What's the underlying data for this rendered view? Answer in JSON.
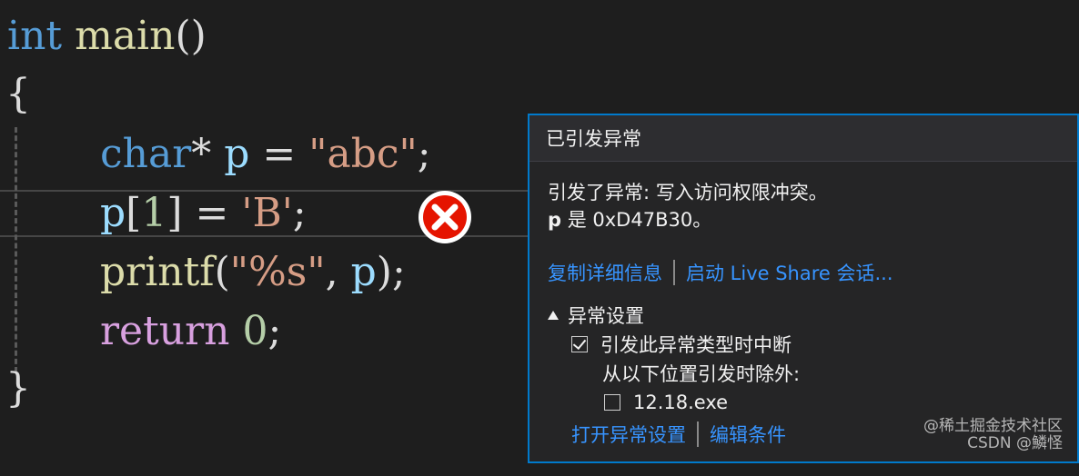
{
  "code": {
    "l1_kw": "int",
    "l1_fn": "main",
    "l1_p": "()",
    "l2": "{",
    "l3_kw": "char",
    "l3_p1": "* ",
    "l3_var": "p",
    "l3_p2": " = ",
    "l3_str": "\"abc\"",
    "l3_p3": ";",
    "l4_var": "p",
    "l4_p1": "[",
    "l4_num": "1",
    "l4_p2": "] = ",
    "l4_str": "'B'",
    "l4_p3": ";",
    "l5_fn": "printf",
    "l5_p1": "(",
    "l5_str": "\"%s\"",
    "l5_p2": ", ",
    "l5_var": "p",
    "l5_p3": ");",
    "l6_ret": "return",
    "l6_sp": " ",
    "l6_num": "0",
    "l6_p": ";",
    "l7": "}"
  },
  "exception_popup": {
    "title": "已引发异常",
    "message_line1": "引发了异常: 写入访问权限冲突。",
    "message_bold": "p",
    "message_line2_rest": " 是 0xD47B30。",
    "link_copy_details": "复制详细信息",
    "link_live_share": "启动 Live Share 会话...",
    "settings_header": "异常设置",
    "break_checkbox_label": "引发此异常类型时中断",
    "break_checkbox_checked": true,
    "except_label": "从以下位置引发时除外:",
    "exe_checkbox_label": "12.18.exe",
    "exe_checkbox_checked": false,
    "link_open_settings": "打开异常设置",
    "link_edit_conditions": "编辑条件"
  },
  "watermark": {
    "line1": "@稀土掘金技术社区",
    "line2": "CSDN @鱗怪"
  },
  "colors": {
    "accent": "#007acc",
    "link": "#3794ff",
    "error_red": "#e51400"
  },
  "icons": {
    "error": "error-circle-x-icon"
  }
}
